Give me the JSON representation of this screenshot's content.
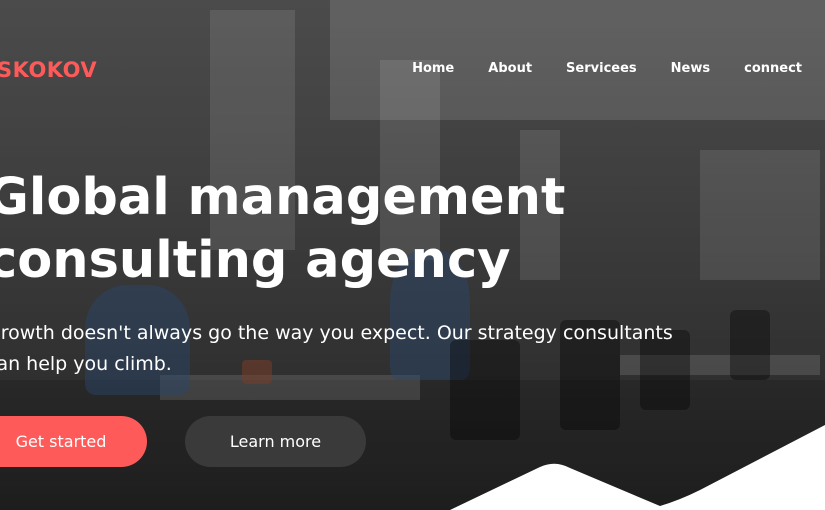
{
  "header": {
    "logo": "SKOKOV",
    "nav": [
      "Home",
      "About",
      "Servicees",
      "News",
      "connect"
    ]
  },
  "hero": {
    "headline": [
      "Global management",
      "consulting agency"
    ],
    "subtitle": "Growth doesn't always go the way you expect. Our strategy consultants can help you climb.",
    "primary_button": "Get started",
    "secondary_button": "Learn more"
  },
  "colors": {
    "accent": "#ff5a5a",
    "secondary_button": "#3a3a3a",
    "text": "#ffffff"
  }
}
